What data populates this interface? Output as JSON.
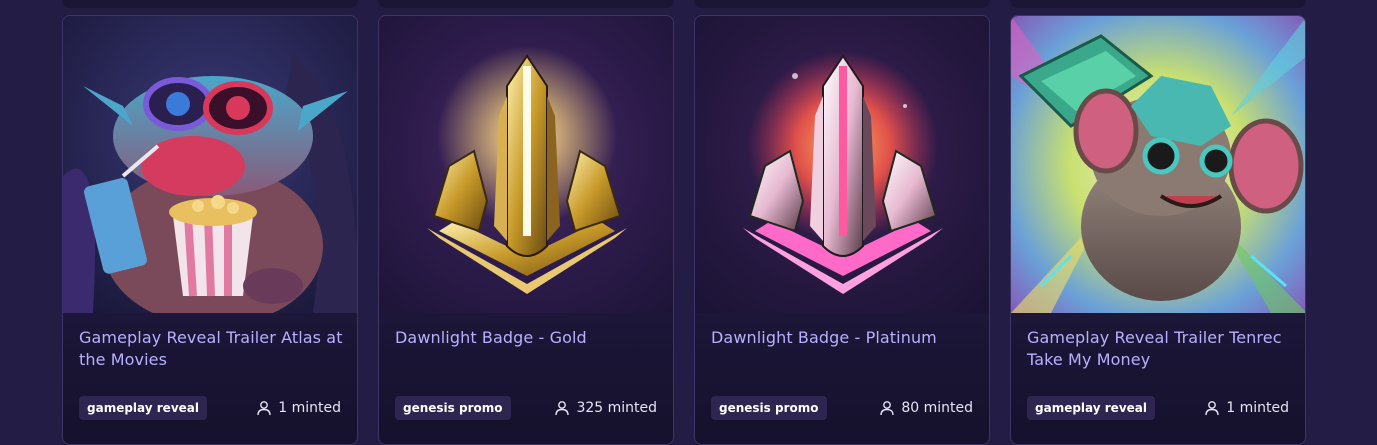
{
  "cards": [
    {
      "title": "Gameplay Reveal Trailer Atlas at the Movies",
      "tag": "gameplay reveal",
      "minted": "1 minted",
      "art": "cartoon-creature-with-3d-glasses-popcorn"
    },
    {
      "title": "Dawnlight Badge - Gold",
      "tag": "genesis promo",
      "minted": "325 minted",
      "art": "gold-crystal-badge"
    },
    {
      "title": "Dawnlight Badge - Platinum",
      "tag": "genesis promo",
      "minted": "80 minted",
      "art": "platinum-crystal-badge"
    },
    {
      "title": "Gameplay Reveal Trailer Tenrec Take My Money",
      "tag": "gameplay reveal",
      "minted": "1 minted",
      "art": "hedgehog-creature-holding-cash"
    }
  ],
  "icons": {
    "minted_icon": "user-icon"
  },
  "colors": {
    "background": "#231d45",
    "card": "#1b1636",
    "title": "#b8b0ff",
    "tag_bg": "#2e2651"
  }
}
